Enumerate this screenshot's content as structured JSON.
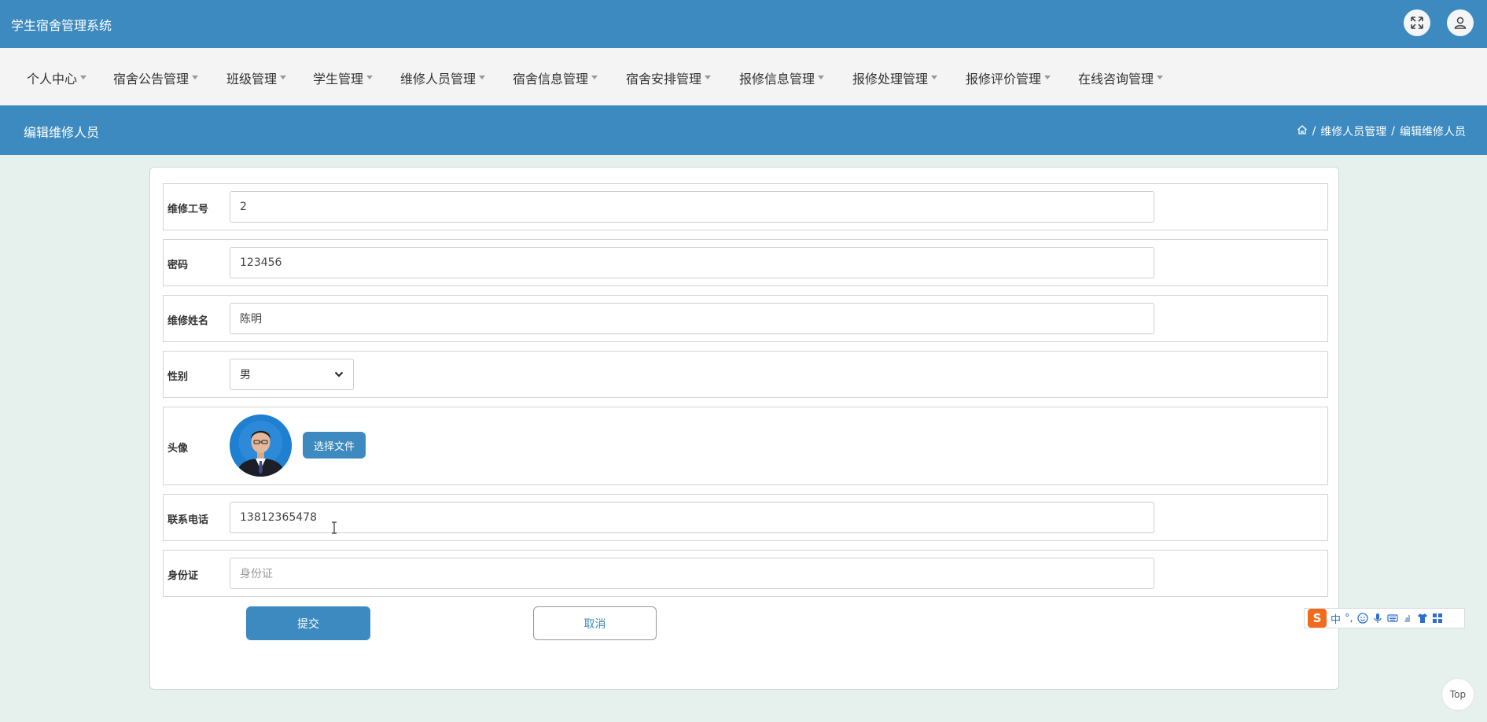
{
  "app": {
    "title": "学生宿舍管理系统"
  },
  "nav": {
    "items": [
      {
        "label": "个人中心"
      },
      {
        "label": "宿舍公告管理"
      },
      {
        "label": "班级管理"
      },
      {
        "label": "学生管理"
      },
      {
        "label": "维修人员管理"
      },
      {
        "label": "宿舍信息管理"
      },
      {
        "label": "宿舍安排管理"
      },
      {
        "label": "报修信息管理"
      },
      {
        "label": "报修处理管理"
      },
      {
        "label": "报修评价管理"
      },
      {
        "label": "在线咨询管理"
      }
    ]
  },
  "page": {
    "title": "编辑维修人员",
    "breadcrumb": {
      "sep": "/",
      "section": "维修人员管理",
      "current": "编辑维修人员"
    }
  },
  "form": {
    "worker_id": {
      "label": "维修工号",
      "value": "2"
    },
    "password": {
      "label": "密码",
      "value": "123456"
    },
    "name": {
      "label": "维修姓名",
      "value": "陈明"
    },
    "gender": {
      "label": "性别",
      "value": "男"
    },
    "avatar": {
      "label": "头像",
      "button": "选择文件"
    },
    "phone": {
      "label": "联系电话",
      "value": "13812365478"
    },
    "id_card": {
      "label": "身份证",
      "value": "",
      "placeholder": "身份证"
    },
    "submit": "提交",
    "cancel": "取消"
  },
  "ime": {
    "mode": "中",
    "punct": "°,"
  },
  "back_to_top": "Top"
}
